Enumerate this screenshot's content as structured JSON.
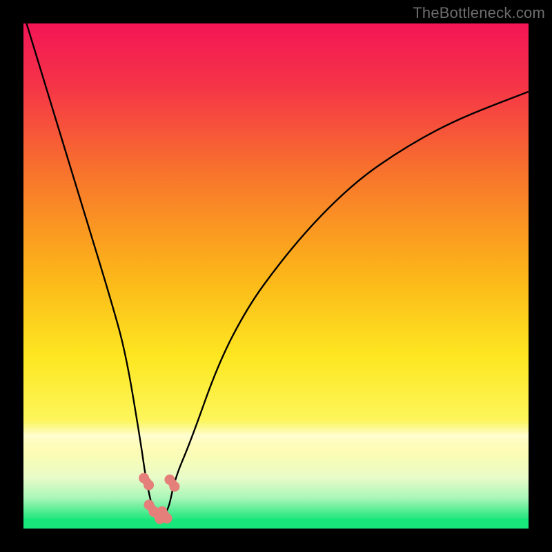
{
  "watermark": "TheBottleneck.com",
  "chart_data": {
    "type": "line",
    "title": "",
    "xlabel": "",
    "ylabel": "",
    "xlim": [
      0,
      100
    ],
    "ylim": [
      0,
      100
    ],
    "grid": false,
    "series": [
      {
        "name": "bottleneck-curve",
        "x": [
          0,
          5.8,
          11.6,
          17.4,
          20.3,
          23.3,
          24.2,
          25.7,
          27.1,
          28.6,
          30.0,
          33.0,
          38.7,
          44.5,
          50.3,
          56.1,
          61.9,
          67.6,
          73.4,
          79.2,
          85.0,
          90.9,
          100.0
        ],
        "y": [
          102,
          83,
          64,
          45,
          34.5,
          16.5,
          10,
          3.2,
          2.6,
          3.2,
          10,
          17,
          33,
          44,
          52,
          59,
          65,
          70,
          74,
          77.5,
          80.5,
          83,
          86.5
        ]
      }
    ],
    "markers": [
      {
        "name": "marker-left-upper",
        "x": 24.4,
        "y": 9.3
      },
      {
        "name": "marker-left-lower",
        "x": 25.4,
        "y": 4.0
      },
      {
        "name": "marker-right-upper",
        "x": 29.5,
        "y": 9.0
      },
      {
        "name": "marker-bottom-a",
        "x": 26.6,
        "y": 2.6
      },
      {
        "name": "marker-bottom-b",
        "x": 28.0,
        "y": 2.7
      }
    ],
    "marker_color": "#e48079",
    "threshold_band": {
      "y0": 14.5,
      "y1": 21.5,
      "color_top": "#f9f9a8",
      "color_bottom": "#ffffe0"
    },
    "floor_band": {
      "y0": 0,
      "y1": 2.0,
      "color": "#18e87c"
    },
    "gradient": {
      "stops": [
        {
          "pos": 0.0,
          "color": "#f31656"
        },
        {
          "pos": 0.12,
          "color": "#f53348"
        },
        {
          "pos": 0.3,
          "color": "#f8752c"
        },
        {
          "pos": 0.5,
          "color": "#fcb619"
        },
        {
          "pos": 0.66,
          "color": "#fde721"
        },
        {
          "pos": 0.79,
          "color": "#fdf65e"
        },
        {
          "pos": 0.85,
          "color": "#fcfcb2"
        },
        {
          "pos": 0.9,
          "color": "#e8fbc8"
        },
        {
          "pos": 0.94,
          "color": "#a8f6b8"
        },
        {
          "pos": 0.975,
          "color": "#33e985"
        },
        {
          "pos": 1.0,
          "color": "#10e37a"
        }
      ]
    }
  }
}
